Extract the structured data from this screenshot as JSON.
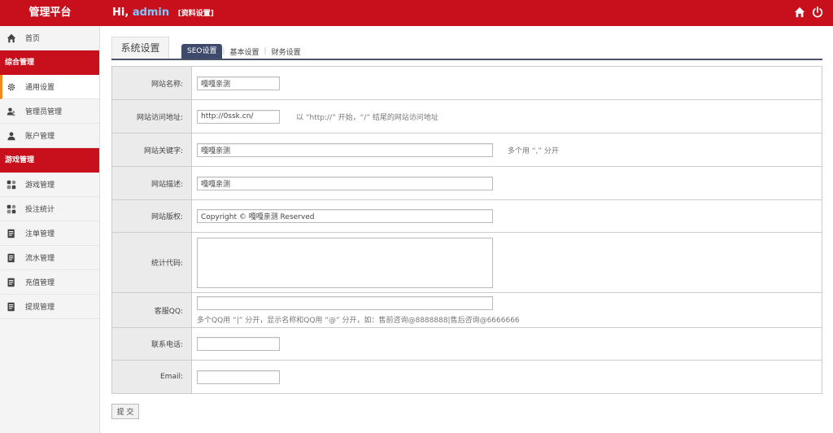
{
  "header": {
    "brand": "管理平台",
    "greeting_prefix": "Hi,",
    "username": "admin",
    "profile_link": "[资料设置]",
    "icons": [
      "home-icon",
      "power-icon"
    ]
  },
  "sidebar": {
    "home": "首页",
    "sections": [
      {
        "title": "综合管理",
        "items": [
          "通用设置",
          "管理员管理",
          "账户管理"
        ]
      },
      {
        "title": "游戏管理",
        "items": [
          "游戏管理",
          "投注统计",
          "注单管理",
          "流水管理",
          "充值管理",
          "提现管理"
        ]
      }
    ]
  },
  "tabs": {
    "main": "系统设置",
    "sub": [
      "SEO设置",
      "基本设置",
      "财务设置"
    ],
    "separator": "|"
  },
  "form": {
    "site_name": {
      "label": "网站名称:",
      "value": "嘎嘎亲测"
    },
    "site_url": {
      "label": "网站访问地址:",
      "value": "http://0ssk.cn/",
      "hint": "以 “http://” 开始，“/” 结尾的网站访问地址"
    },
    "keywords": {
      "label": "网站关键字:",
      "value": "嘎嘎亲测",
      "hint": "多个用 “,” 分开"
    },
    "description": {
      "label": "网站描述:",
      "value": "嘎嘎亲测"
    },
    "copyright": {
      "label": "网站版权:",
      "value": "Copyright © 嘎嘎亲测 Reserved"
    },
    "stats_code": {
      "label": "统计代码:",
      "value": ""
    },
    "service_qq": {
      "label": "客服QQ:",
      "value": "",
      "hint": "多个QQ用 “|” 分开，显示名称和QQ用 “@” 分开，如：售前咨询@8888888|售后咨询@6666666"
    },
    "phone": {
      "label": "联系电话:",
      "value": ""
    },
    "email": {
      "label": "Email:",
      "value": ""
    },
    "submit_label": "提 交"
  },
  "colors": {
    "header_red": "#c8101c",
    "active_tab": "#3d4a6b",
    "active_marker": "#f08a1c"
  }
}
